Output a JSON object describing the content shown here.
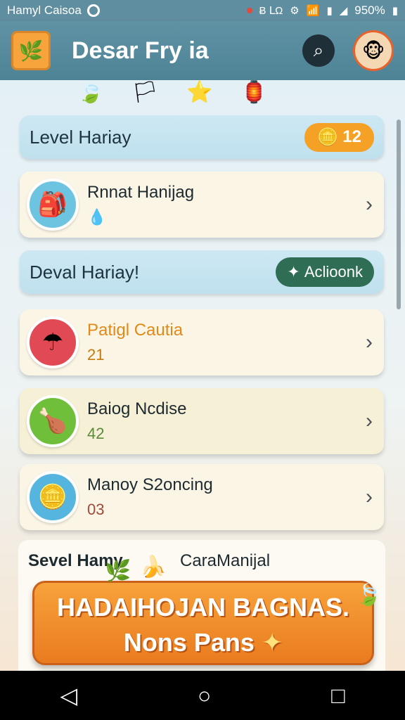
{
  "status_bar": {
    "carrier": "Hamyl Caisoa",
    "time": "",
    "right_text": "Ƀ ⅬΩ",
    "battery": "950%"
  },
  "app_bar": {
    "title": "Desar Fry ia",
    "logo_icon": "app-logo-icon",
    "search_icon": "search-icon",
    "avatar_icon": "avatar-icon"
  },
  "sections": [
    {
      "title": "Level Hariay",
      "badge": "12",
      "badge_icon": "coin-icon"
    },
    {
      "title": "Deval Hariay!",
      "badge": "Aclioonk",
      "badge_icon": "sparkle-icon"
    }
  ],
  "cards": [
    {
      "title": "Rnnat Hanijag",
      "sub": "💧",
      "icon": "backpack-icon",
      "icon_bg": "#6cc4e0"
    },
    {
      "title": "Patigl Cautia",
      "sub": "21",
      "icon": "umbrella-icon",
      "icon_bg": "#e14a55"
    },
    {
      "title": "Baiog Ncdise",
      "sub": "42",
      "icon": "drumstick-icon",
      "icon_bg": "#6fbf3b"
    },
    {
      "title": "Manoy S2oncing",
      "sub": "03",
      "icon": "coin-pet-icon",
      "icon_bg": "#56b5de"
    }
  ],
  "bottom": {
    "title": "Sevel Hamy",
    "sub": "CaraManijal"
  },
  "promo": {
    "line1": "HADAIHOJAN BAGNAS.",
    "line2": "Nons Pans"
  },
  "colors": {
    "status_bar": "#5f8ea0",
    "app_bar": "#5f93a4",
    "accent_orange": "#f5a126",
    "accent_green": "#2f6e55"
  }
}
